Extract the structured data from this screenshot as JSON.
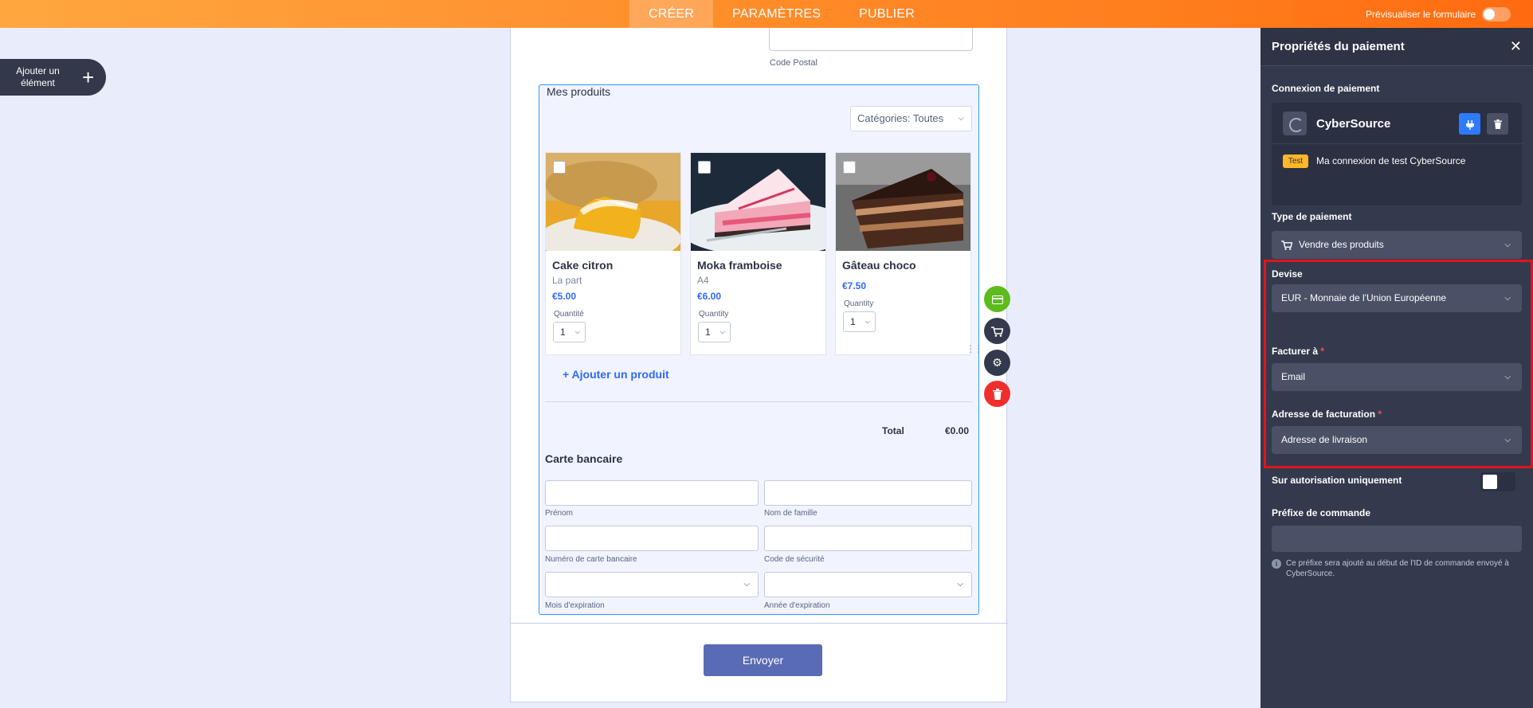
{
  "topbar": {
    "tabs": [
      "CRÉER",
      "PARAMÈTRES",
      "PUBLIER"
    ],
    "preview_label": "Prévisualiser le formulaire"
  },
  "add_element": {
    "label": "Ajouter un élément"
  },
  "form": {
    "postal_label": "Code Postal",
    "products_title": "Mes produits",
    "category_select": "Catégories: Toutes",
    "products": [
      {
        "name": "Cake citron",
        "sub": "La part",
        "price": "€5.00",
        "qty_label": "Quantité",
        "qty": "1"
      },
      {
        "name": "Moka framboise",
        "sub": "A4",
        "price": "€6.00",
        "qty_label": "Quantity",
        "qty": "1"
      },
      {
        "name": "Gâteau choco",
        "sub": "",
        "price": "€7.50",
        "qty_label": "Quantity",
        "qty": "1"
      }
    ],
    "add_product": "+ Ajouter un produit",
    "total_label": "Total",
    "total_value": "€0.00",
    "card_title": "Carte bancaire",
    "fields": {
      "first_name": "Prénom",
      "last_name": "Nom de famille",
      "card_number": "Numéro de carte bancaire",
      "security_code": "Code de sécurité",
      "exp_month": "Mois d'expiration",
      "exp_year": "Année d'expiration"
    },
    "submit": "Envoyer"
  },
  "panel": {
    "title": "Propriétés du paiement",
    "connection_label": "Connexion de paiement",
    "provider": "CyberSource",
    "badge": "Test",
    "connection_name": "Ma connexion de test CyberSource",
    "payment_type_label": "Type de paiement",
    "payment_type": "Vendre des produits",
    "currency_label": "Devise",
    "currency": "EUR - Monnaie de l'Union Européenne",
    "bill_to_label": "Facturer à",
    "bill_to": "Email",
    "billing_address_label": "Adresse de facturation",
    "billing_address": "Adresse de livraison",
    "auth_only_label": "Sur autorisation uniquement",
    "order_prefix_label": "Préfixe de commande",
    "help_text": "Ce préfixe sera ajouté au début de l'ID de commande envoyé à CyberSource."
  },
  "colors": {
    "accent": "#2e69ff",
    "topbar": "#ff7b1c",
    "panel_bg": "#343a4d",
    "highlight": "#e0151c"
  }
}
